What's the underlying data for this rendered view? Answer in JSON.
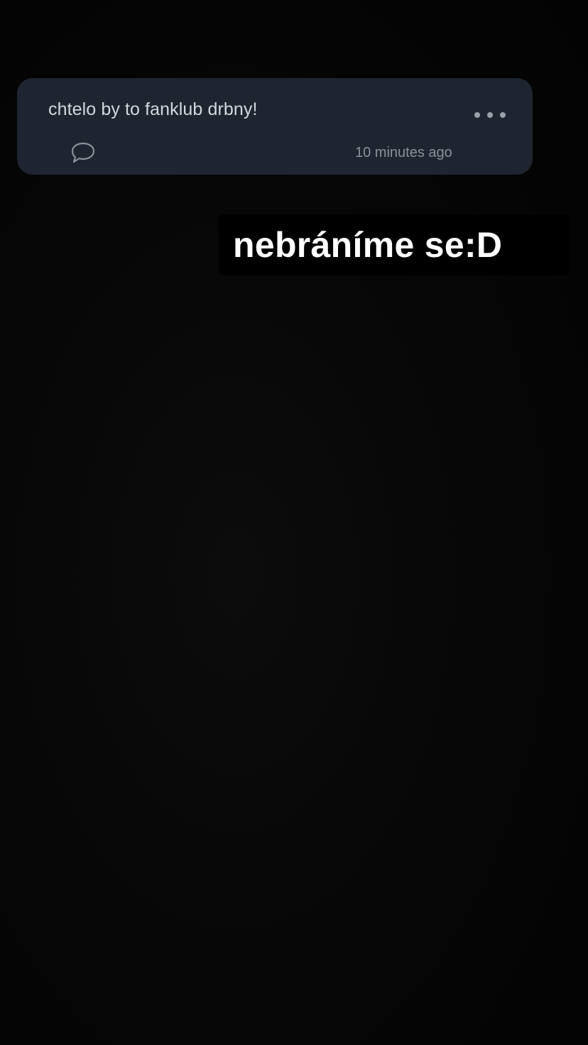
{
  "question_card": {
    "text": "chtelo by to fanklub drbny!",
    "timestamp": "10 minutes ago",
    "more_icon": "more-horizontal-icon",
    "comment_icon": "speech-bubble-icon"
  },
  "caption": {
    "text": "nebráníme se:D"
  },
  "colors": {
    "background": "#050505",
    "card": "#1e2530",
    "card_text": "#d4d8de",
    "muted_text": "#8a919b",
    "caption_text": "#ffffff"
  }
}
